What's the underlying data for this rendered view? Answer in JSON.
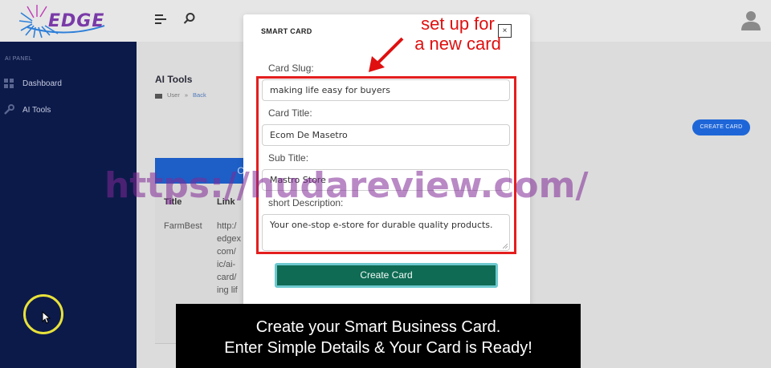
{
  "topbar": {
    "logo_text": "EDGE",
    "menu_icon": "menu-lines-icon",
    "search_icon": "search-icon",
    "avatar_icon": "user-avatar-icon"
  },
  "sidebar": {
    "heading": "AI PANEL",
    "items": [
      {
        "label": "Dashboard",
        "icon": "dashboard-icon"
      },
      {
        "label": "AI Tools",
        "icon": "wrench-icon"
      }
    ]
  },
  "main": {
    "title": "AI Tools",
    "breadcrumb": {
      "home": "User",
      "separator": "»",
      "current": "Back"
    },
    "create_button": "CREATE CARD",
    "table": {
      "header_fragment": "C",
      "columns": [
        "Title",
        "Link"
      ],
      "rows": [
        {
          "title": "FarmBest",
          "link_lines": [
            "http:/",
            "edgex",
            "com/",
            "ic/ai-",
            "card/",
            "ing lif"
          ]
        }
      ]
    }
  },
  "modal": {
    "title": "SMART CARD",
    "close_label": "×",
    "fields": {
      "slug_label": "Card Slug:",
      "slug_value": "making life easy for buyers",
      "title_label": "Card Title:",
      "title_value": "Ecom De Masetro",
      "subtitle_label": "Sub Title:",
      "subtitle_value": "Mastro Store",
      "description_label": "short Description:",
      "description_value": "Your one-stop e-store for durable quality products."
    },
    "submit_label": "Create Card"
  },
  "annotation": {
    "line1": "set up for",
    "line2": "a new card",
    "color": "#e01010"
  },
  "watermark": "https://hudareview.com/",
  "caption": {
    "line1": "Create your Smart Business Card.",
    "line2": "Enter Simple Details & Your Card is Ready!"
  },
  "colors": {
    "sidebar_bg": "#0c1a4a",
    "accent_blue": "#1e66d8",
    "submit_green": "#0f6b53",
    "highlight_red": "#e41e1e"
  }
}
